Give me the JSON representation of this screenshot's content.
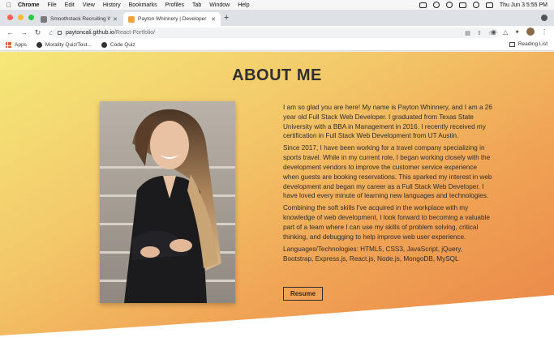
{
  "menubar": {
    "items": [
      "Chrome",
      "File",
      "Edit",
      "View",
      "History",
      "Bookmarks",
      "Profiles",
      "Tab",
      "Window",
      "Help"
    ],
    "datetime": "Thu Jun 3  5:55 PM"
  },
  "tabs": [
    {
      "title": "Smoothstack Recruiting Webi...",
      "active": false
    },
    {
      "title": "Payton Whinnery | Developer",
      "active": true
    }
  ],
  "address": {
    "host": "paytoncali.github.io",
    "path": "/React-Portfolio/"
  },
  "bookmarks": {
    "items": [
      "Apps",
      "Morality Quiz/Test...",
      "Code Quiz"
    ],
    "reading_list": "Reading List"
  },
  "page": {
    "title": "ABOUT ME",
    "paragraphs": [
      "I am so glad you are here! My name is Payton Whinnery, and I am a 26 year old Full Stack Web Developer. I graduated from Texas State University with a BBA in Management in 2016. I recently received my certification in Full Stack Web Development from UT Austin.",
      "Since 2017, I have been working for a travel company specializing in sports travel. While in my current role, I began working closely with the development vendors to improve the customer service experience when guests are booking reservations. This sparked my interest in web development and began my career as a Full Stack Web Developer. I have loved every minute of learning new languages and technologies.",
      "Combining the soft skills I've acquired in the workplace with my knowledge of web development, I look forward to becoming a valuable part of a team where I can use my skills of problem solving, critical thinking, and debugging to help improve web user experience.",
      "Languages/Technologies: HTML5, CSS3, JavaScript, jQuery, Bootstrap, Express.js, React.js, Node.js, MongoDB, MySQL"
    ],
    "resume_label": "Resume"
  },
  "colors": {
    "gradient_start": "#f5e878",
    "gradient_end": "#e98447",
    "text": "#2d2d2d"
  }
}
